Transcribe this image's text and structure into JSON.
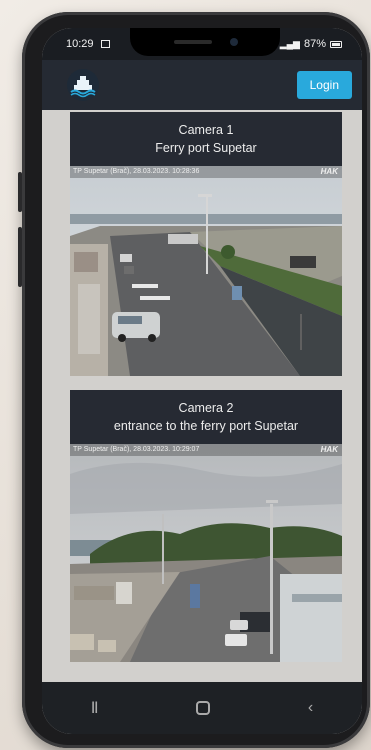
{
  "status": {
    "time": "10:29",
    "battery": "87%"
  },
  "header": {
    "login_label": "Login"
  },
  "cameras": [
    {
      "number": "Camera 1",
      "location": "Ferry port Supetar",
      "overlay": "TP Supetar (Brač), 28.03.2023. 10:28:36",
      "brand": "HAK"
    },
    {
      "number": "Camera 2",
      "location": "entrance to the ferry port Supetar",
      "overlay": "TP Supetar (Brač), 28.03.2023. 10:29:07",
      "brand": "HAK"
    }
  ],
  "nav": {
    "recents_icon": "recents-icon",
    "home_icon": "home-icon",
    "back_icon": "back-icon"
  }
}
